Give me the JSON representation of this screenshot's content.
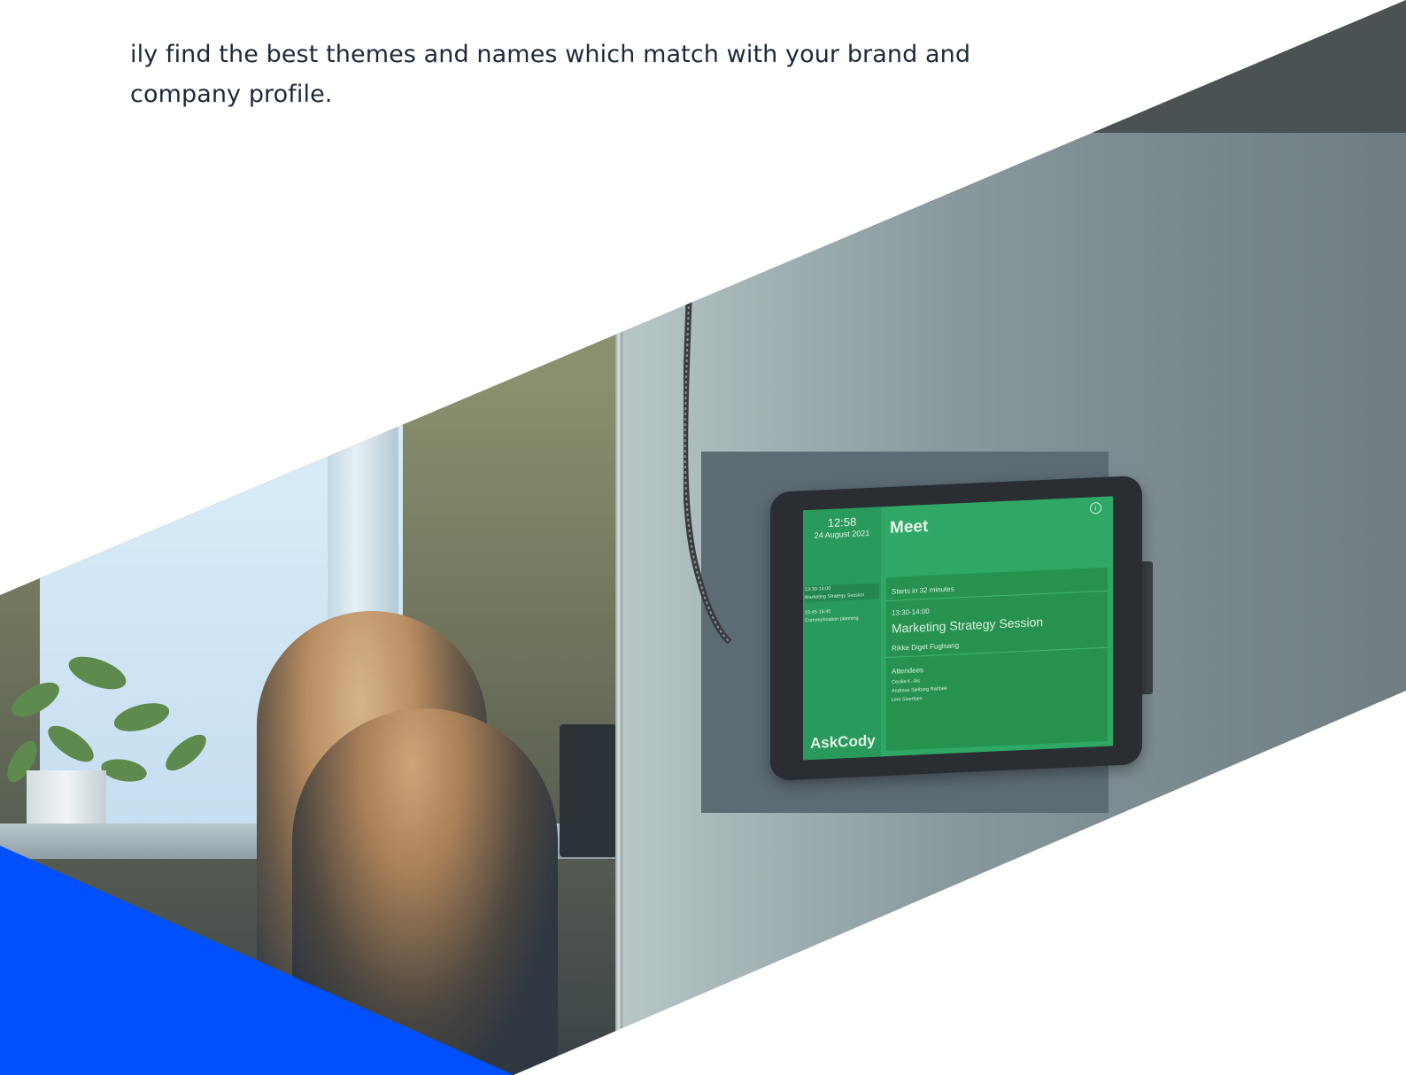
{
  "intro": {
    "line1": "ily find the best themes and names which match with your brand and",
    "line2": "company profile."
  },
  "tablet": {
    "time": "12:58",
    "date": "24 August 2021",
    "room": "Meet",
    "bookings": [
      {
        "time": "13:30-14:00",
        "title": "Marketing Strategy Session"
      },
      {
        "time": "15:45-16:45",
        "title": "Communication planning"
      }
    ],
    "brand": "AskCody",
    "starts_in": "Starts in 32 minutes",
    "meeting_time": "13:30-14:00",
    "meeting_title": "Marketing Strategy Session",
    "organizer": "Rikke Diget Fuglsang",
    "attendees_label": "Attendees",
    "attendees": [
      "Cecilie K. Als",
      "Andreas Sjelborg Rahbek",
      "Line Sivertsen"
    ],
    "info_glyph": "i"
  },
  "colors": {
    "accent_blue": "#0050ff",
    "screen_green": "#2fa865"
  }
}
